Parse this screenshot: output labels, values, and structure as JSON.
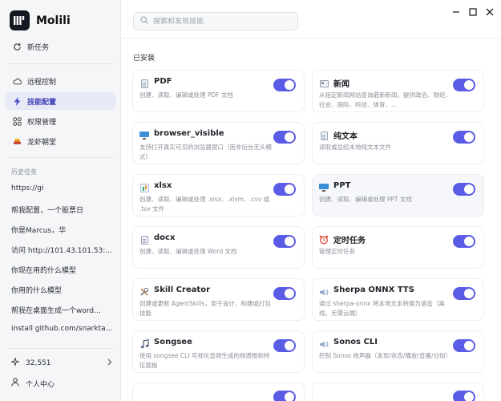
{
  "app": {
    "name": "Molili"
  },
  "nav": {
    "new_task": "新任务",
    "remote": "远程控制",
    "skills": "技能配置",
    "perms": "权限管理",
    "lobster": "龙虾朝堂"
  },
  "history": {
    "label": "历史任务",
    "items": [
      "https://gi",
      "帮我配置，一个股票日",
      "你是Marcus，华",
      "访问 http://101.43.101.53:...",
      "你现在用的什么模型",
      "你用的什么模型",
      "帮我在桌面生成一个word...",
      "install github.com/snarkta..."
    ]
  },
  "footer": {
    "credits": "32,551",
    "account": "个人中心"
  },
  "search": {
    "placeholder": "搜索和发现技能"
  },
  "section": {
    "installed": "已安装"
  },
  "skills": [
    {
      "title": "PDF",
      "desc": "创建、读取、编辑或处理 PDF 文档",
      "icon": "document-icon",
      "enabled": true
    },
    {
      "title": "新闻",
      "desc": "从指定新闻网站查询最新新闻，提供政治、财经、社会、国际、科技、体育、...",
      "icon": "newspaper-icon",
      "enabled": true
    },
    {
      "title": "browser_visible",
      "desc": "支持打开真实可见的浏览器窗口（而非后台无头模式）",
      "icon": "monitor-icon",
      "enabled": true
    },
    {
      "title": "纯文本",
      "desc": "读取或总结本地纯文本文件",
      "icon": "document-icon",
      "enabled": true
    },
    {
      "title": "xlsx",
      "desc": "创建、读取、编辑或处理 .xlsx、.xlsm、.csv 或 .tsv 文件",
      "icon": "spreadsheet-icon",
      "enabled": true
    },
    {
      "title": "PPT",
      "desc": "创建、读取、编辑或处理 PPT 文档",
      "icon": "monitor-icon",
      "enabled": true
    },
    {
      "title": "docx",
      "desc": "创建、读取、编辑或处理 Word 文档",
      "icon": "document-icon",
      "enabled": true
    },
    {
      "title": "定时任务",
      "desc": "管理定时任务",
      "icon": "alarm-clock-icon",
      "enabled": true
    },
    {
      "title": "Skill Creator",
      "desc": "创建或更新 AgentSkills，用于设计、构建或打包技能",
      "icon": "tools-icon",
      "enabled": true
    },
    {
      "title": "Sherpa ONNX TTS",
      "desc": "通过 sherpa-onnx 将本地文本转换为语音（离线，无需云端）",
      "icon": "speaker-icon",
      "enabled": true
    },
    {
      "title": "Songsee",
      "desc": "使用 songsee CLI 可视化音频生成的频谱图和特征面板",
      "icon": "music-note-icon",
      "enabled": true
    },
    {
      "title": "Sonos CLI",
      "desc": "控制 Sonos 扬声器（发现/状态/播放/音量/分组）",
      "icon": "speaker-icon",
      "enabled": true
    }
  ],
  "colors": {
    "accent": "#5b5ce6",
    "sidebar_bg": "#f5f6f8",
    "active_nav_bg": "#e8e9f7"
  }
}
